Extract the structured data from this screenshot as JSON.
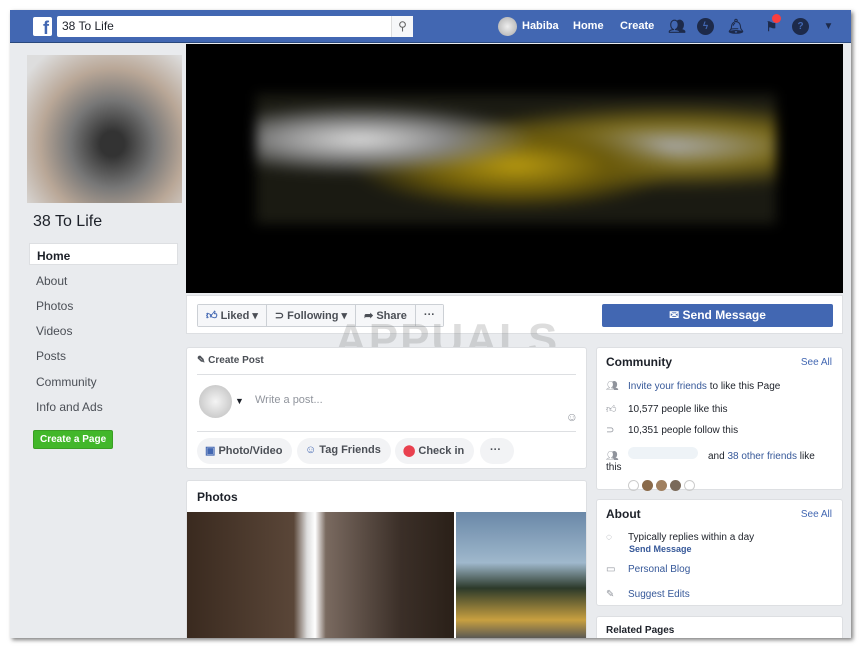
{
  "header": {
    "search_value": "38 To Life",
    "user": "Habiba",
    "home": "Home",
    "create": "Create"
  },
  "sidebar": {
    "page_title": "38 To Life",
    "items": [
      {
        "label": "Home"
      },
      {
        "label": "About"
      },
      {
        "label": "Photos"
      },
      {
        "label": "Videos"
      },
      {
        "label": "Posts"
      },
      {
        "label": "Community"
      },
      {
        "label": "Info and Ads"
      }
    ],
    "create_page": "Create a Page"
  },
  "actions": {
    "liked": "Liked",
    "following": "Following",
    "share": "Share",
    "more": "···",
    "send_message": "Send Message"
  },
  "watermark": "APPUALS",
  "create_post": {
    "title": "Create Post",
    "placeholder": "Write a post...",
    "photo_video": "Photo/Video",
    "tag_friends": "Tag Friends",
    "check_in": "Check in",
    "more": "···"
  },
  "photos": {
    "title": "Photos"
  },
  "community": {
    "title": "Community",
    "see_all": "See All",
    "invite_link": "Invite your friends",
    "invite_rest": " to like this Page",
    "likes": "10,577 people like this",
    "follows": "10,351 people follow this",
    "friends_pre": "and ",
    "friends_link": "38 other friends",
    "friends_post": " like this"
  },
  "about": {
    "title": "About",
    "see_all": "See All",
    "replies": "Typically replies within a day",
    "send_message": "Send Message",
    "category": "Personal Blog",
    "suggest": "Suggest Edits"
  },
  "related": {
    "title": "Related Pages"
  }
}
